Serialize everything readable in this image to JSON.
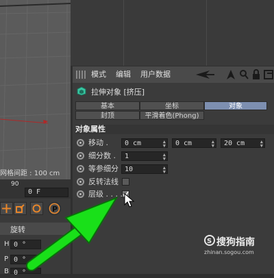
{
  "viewport": {
    "grid_spacing": "网格间距 : 100 cm"
  },
  "timeline": {
    "ruler_mark": "90",
    "frame_value": "0 F"
  },
  "lower_left": {
    "rotation_tab": "旋转",
    "coords": [
      {
        "axis": "H",
        "value": "0 °"
      },
      {
        "axis": "P",
        "value": "0 °"
      },
      {
        "axis": "B",
        "value": "0 °"
      }
    ]
  },
  "attr_menu": {
    "mode": "模式",
    "edit": "编辑",
    "user_data": "用户数据"
  },
  "object": {
    "title": "拉伸对象 [挤压]"
  },
  "tabs": {
    "basic": "基本",
    "coord": "坐标",
    "object": "对象",
    "caps": "封顶",
    "phong": "平滑着色(Phong)"
  },
  "section": {
    "title": "对象属性"
  },
  "props": {
    "move": {
      "label": "移动 .",
      "x": "0 cm",
      "y": "0 cm",
      "z": "20 cm"
    },
    "subdiv": {
      "label": "细分数 .",
      "value": "1"
    },
    "iso": {
      "label": "等参细分",
      "value": "10"
    },
    "flip": {
      "label": "反转法线"
    },
    "hierarchy": {
      "label": "层级 . . . .",
      "checked": true
    }
  },
  "watermark": {
    "brand": "搜狗指南",
    "url": "zhinan.sogou.com"
  },
  "colors": {
    "active_tab": "#7d8fb0",
    "arrow": "#19e019",
    "panel": "#3b3b3b"
  }
}
